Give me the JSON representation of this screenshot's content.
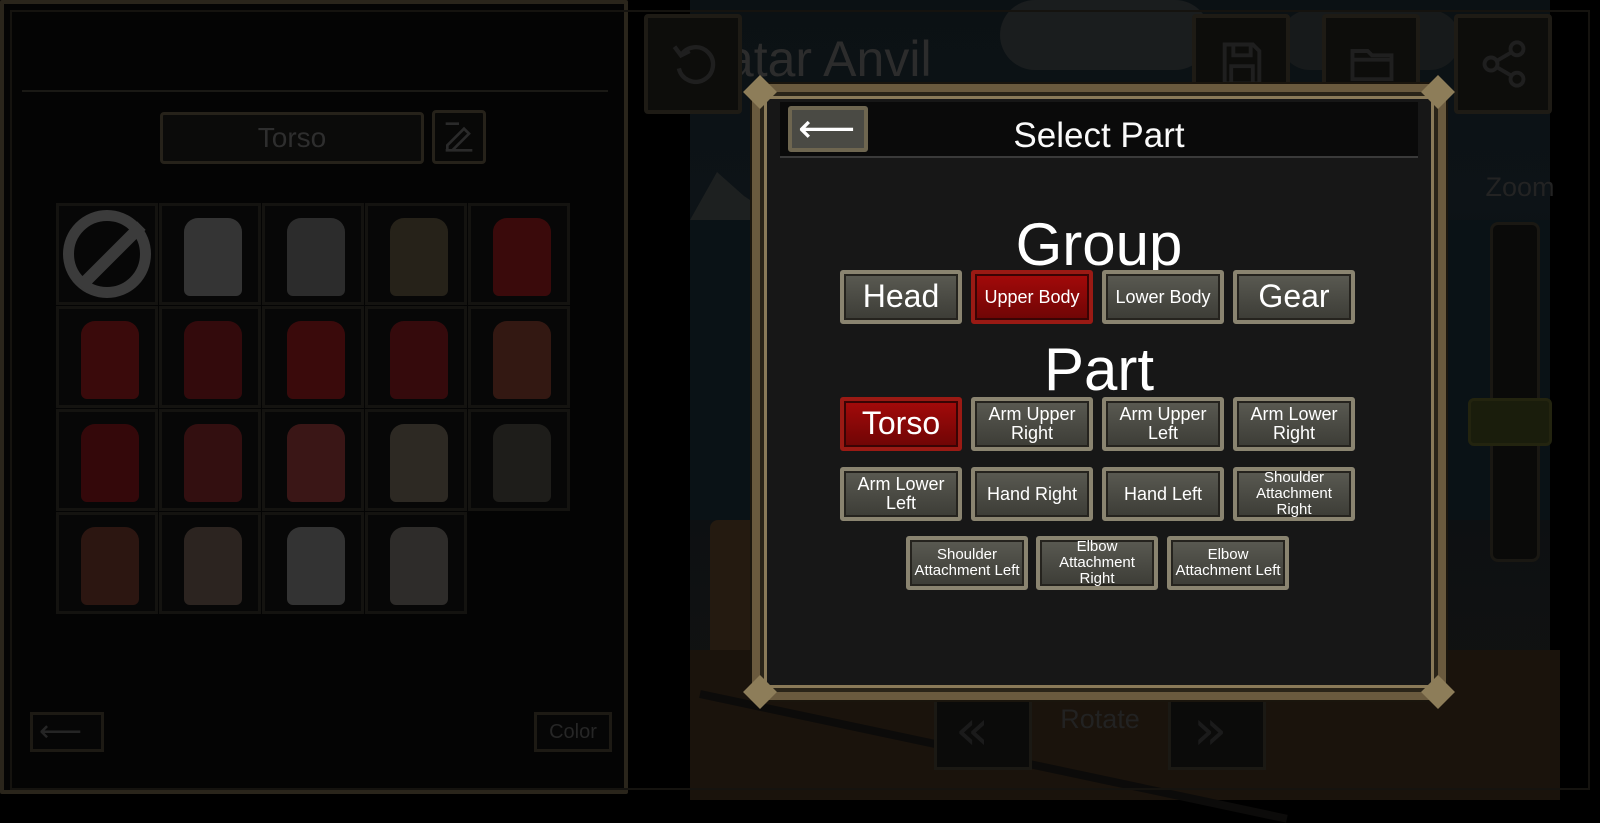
{
  "left_panel": {
    "title": "Avatar Anvil",
    "part_label": "Torso",
    "color_button": "Color",
    "back_arrow": "⟵"
  },
  "items": [
    {
      "kind": "none"
    },
    {
      "color": "#6d6d6d"
    },
    {
      "color": "#5a5a5a"
    },
    {
      "color": "#4d4530"
    },
    {
      "color": "#7a0f12"
    },
    {
      "color": "#7a0f12"
    },
    {
      "color": "#6a1014"
    },
    {
      "color": "#7a0f12"
    },
    {
      "color": "#6e1014"
    },
    {
      "color": "#6a2f22"
    },
    {
      "color": "#6d0c10"
    },
    {
      "color": "#6b1a1c"
    },
    {
      "color": "#7a2a2a"
    },
    {
      "color": "#5e5448"
    },
    {
      "color": "#3b3a32"
    },
    {
      "color": "#5a2a20"
    },
    {
      "color": "#5a4a40"
    },
    {
      "color": "#6a6a6a"
    },
    {
      "color": "#5f5b56"
    }
  ],
  "scene": {
    "zoom_label": "Zoom",
    "rotate_label": "Rotate",
    "rotate_left": "«",
    "rotate_right": "»"
  },
  "dialog": {
    "title": "Select Part",
    "back_arrow": "⟵",
    "group_title": "Group",
    "part_title": "Part",
    "groups": [
      {
        "label": "Head",
        "selected": false,
        "size": "lg"
      },
      {
        "label": "Upper Body",
        "selected": true,
        "size": "md"
      },
      {
        "label": "Lower Body",
        "selected": false,
        "size": "md"
      },
      {
        "label": "Gear",
        "selected": false,
        "size": "lg"
      }
    ],
    "parts": [
      {
        "label": "Torso",
        "selected": true,
        "size": "lg"
      },
      {
        "label": "Arm Upper Right",
        "selected": false,
        "size": "md"
      },
      {
        "label": "Arm Upper Left",
        "selected": false,
        "size": "md"
      },
      {
        "label": "Arm Lower Right",
        "selected": false,
        "size": "md"
      },
      {
        "label": "Arm Lower Left",
        "selected": false,
        "size": "md"
      },
      {
        "label": "Hand Right",
        "selected": false,
        "size": "md"
      },
      {
        "label": "Hand Left",
        "selected": false,
        "size": "md"
      },
      {
        "label": "Shoulder Attachment Right",
        "selected": false,
        "size": "sm"
      },
      {
        "label": "Shoulder Attachment Left",
        "selected": false,
        "size": "sm"
      },
      {
        "label": "Elbow Attachment Right",
        "selected": false,
        "size": "sm"
      },
      {
        "label": "Elbow Attachment Left",
        "selected": false,
        "size": "sm"
      }
    ]
  },
  "icons": {
    "undo": "undo-icon",
    "save": "save-icon",
    "folder": "folder-icon",
    "share": "share-icon",
    "edit": "edit-icon",
    "none": "no-item-icon"
  }
}
